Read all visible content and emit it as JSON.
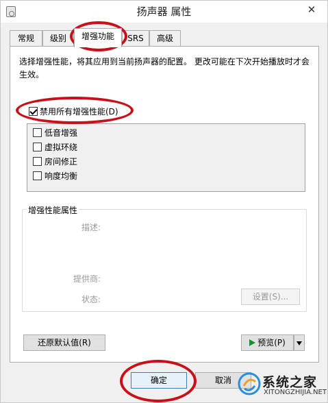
{
  "window": {
    "title": "扬声器 属性",
    "close_glyph": "✕"
  },
  "tabs": [
    {
      "label": "常规",
      "active": false
    },
    {
      "label": "级别",
      "active": false
    },
    {
      "label": "增强功能",
      "active": true
    },
    {
      "label": "SRS",
      "active": false
    },
    {
      "label": "高级",
      "active": false
    }
  ],
  "enhancements": {
    "description": "选择增强性能，将其应用到当前扬声器的配置。 更改可能在下次开始播放时才会生效。",
    "disable_all": {
      "label": "禁用所有增强性能(D)",
      "checked": true
    },
    "items": [
      {
        "label": "低音增强",
        "checked": false
      },
      {
        "label": "虚拟环绕",
        "checked": false
      },
      {
        "label": "房间修正",
        "checked": false
      },
      {
        "label": "响度均衡",
        "checked": false
      }
    ]
  },
  "properties": {
    "group_title": "增强性能属性",
    "description_label": "描述:",
    "provider_label": "提供商:",
    "status_label": "状态:",
    "settings_button": "设置(S)..."
  },
  "buttons": {
    "restore_defaults": "还原默认值(R)",
    "preview": "预览(P)",
    "ok": "确定",
    "cancel": "取消"
  },
  "annotation_color": "#c8101a",
  "watermark": {
    "text": "系统之家",
    "url": "XITONGZHIJIA.NET"
  }
}
